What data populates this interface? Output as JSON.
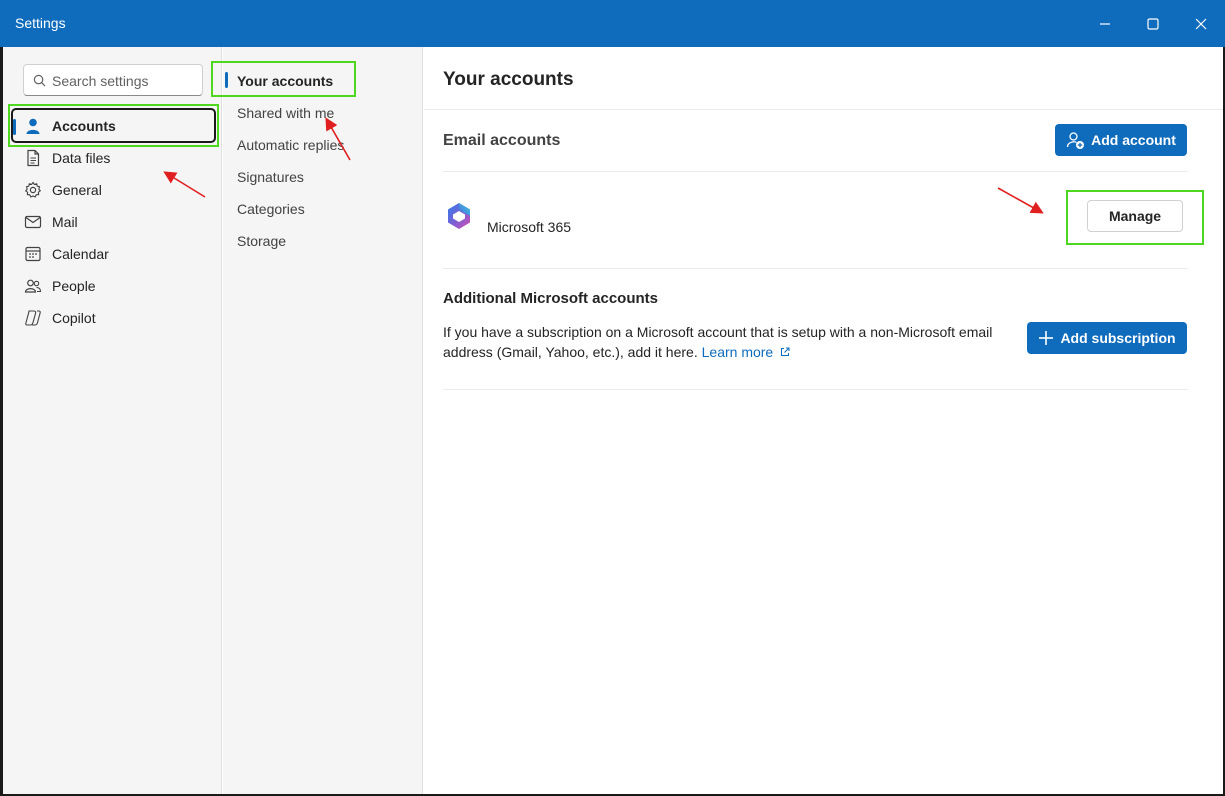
{
  "window": {
    "title": "Settings",
    "controls": [
      "minimize-icon",
      "maximize-icon",
      "close-icon"
    ],
    "titlebar_color": "#0f6cbd"
  },
  "search": {
    "placeholder": "Search settings"
  },
  "nav": {
    "items": [
      {
        "label": "Accounts",
        "icon": "person-icon",
        "selected": true
      },
      {
        "label": "Data files",
        "icon": "document-icon"
      },
      {
        "label": "General",
        "icon": "gear-icon"
      },
      {
        "label": "Mail",
        "icon": "mail-icon"
      },
      {
        "label": "Calendar",
        "icon": "calendar-icon"
      },
      {
        "label": "People",
        "icon": "people-icon"
      },
      {
        "label": "Copilot",
        "icon": "copilot-icon"
      }
    ]
  },
  "subnav": {
    "items": [
      {
        "label": "Your accounts",
        "selected": true
      },
      {
        "label": "Shared with me"
      },
      {
        "label": "Automatic replies"
      },
      {
        "label": "Signatures"
      },
      {
        "label": "Categories"
      },
      {
        "label": "Storage"
      }
    ]
  },
  "content": {
    "title": "Your accounts",
    "email_section": {
      "heading": "Email accounts",
      "add_button": "Add account",
      "account": {
        "name": "Microsoft 365",
        "logo": "microsoft-365-logo"
      },
      "manage_button": "Manage"
    },
    "additional_section": {
      "heading": "Additional Microsoft accounts",
      "description": "If you have a subscription on a Microsoft account that is setup with a non-Microsoft email address (Gmail, Yahoo, etc.), add it here.",
      "link_text": "Learn more",
      "add_button": "Add subscription"
    }
  },
  "colors": {
    "accent": "#0f6cbd",
    "highlight_box": "#4fd61f",
    "annotation_arrow": "#e02020"
  }
}
